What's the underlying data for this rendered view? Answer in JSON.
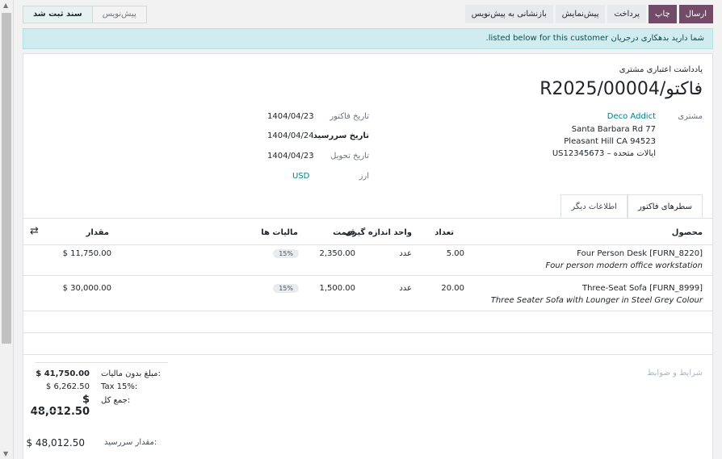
{
  "status": {
    "posted": "سند ثبت شد",
    "draft": "پیش‌نویس"
  },
  "actions": {
    "send": "ارسال",
    "print": "چاپ",
    "pay": "پرداخت",
    "preview": "پیش‌نمایش",
    "reset": "بازنشانی به پیش‌نویس"
  },
  "alert": "شما دارید بدهکاری درجریان listed below for this customer.",
  "header": {
    "doc_type": "یادداشت اعتباری مشتری",
    "title": "Rفاکتو/2025/00004"
  },
  "customer": {
    "label": "مشتری",
    "name": "Deco Addict",
    "address1": "Santa Barbara Rd 77",
    "address2": "Pleasant Hill CA 94523",
    "address3": "ایالات متحده – US12345673"
  },
  "fields": {
    "invoice_date_label": "تاریخ فاکتور",
    "invoice_date": "1404/04/23",
    "due_date_label": "تاریخ سررسید",
    "due_date": "1404/04/24",
    "delivery_date_label": "تاریخ تحویل",
    "delivery_date": "1404/04/23",
    "currency_label": "ارز",
    "currency": "USD"
  },
  "tabs": {
    "lines": "سطرهای فاکتور",
    "other": "اطلاعات دیگر"
  },
  "columns": {
    "product": "محصول",
    "quantity": "تعداد",
    "uom": "واحد اندازه گیری",
    "price": "قیمت",
    "taxes": "مالیات ها",
    "amount": "مقدار"
  },
  "lines": [
    {
      "product": "Four Person Desk [FURN_8220]",
      "description": "Four person modern office workstation",
      "quantity": "5.00",
      "uom": "عدد",
      "price": "2,350.00",
      "tax": "15%",
      "amount": "$ 11,750.00"
    },
    {
      "product": "Three-Seat Sofa [FURN_8999]",
      "description": "Three Seater Sofa with Lounger in Steel Grey Colour",
      "quantity": "20.00",
      "uom": "عدد",
      "price": "1,500.00",
      "tax": "15%",
      "amount": "$ 30,000.00"
    }
  ],
  "terms_placeholder": "شرایط و ضوابط",
  "totals": {
    "untaxed_label": "مبلغ بدون مالیات:",
    "untaxed": "$ 41,750.00",
    "tax_label": "Tax 15%:",
    "tax": "$ 6,262.50",
    "total_label": "جمع کل:",
    "total": "$ 48,012.50",
    "due_label": "مقدار سررسید:",
    "due": "$ 48,012.50"
  },
  "colors": {
    "primary": "#714b67",
    "link": "#017e84",
    "alert_bg": "#d0ecee"
  }
}
